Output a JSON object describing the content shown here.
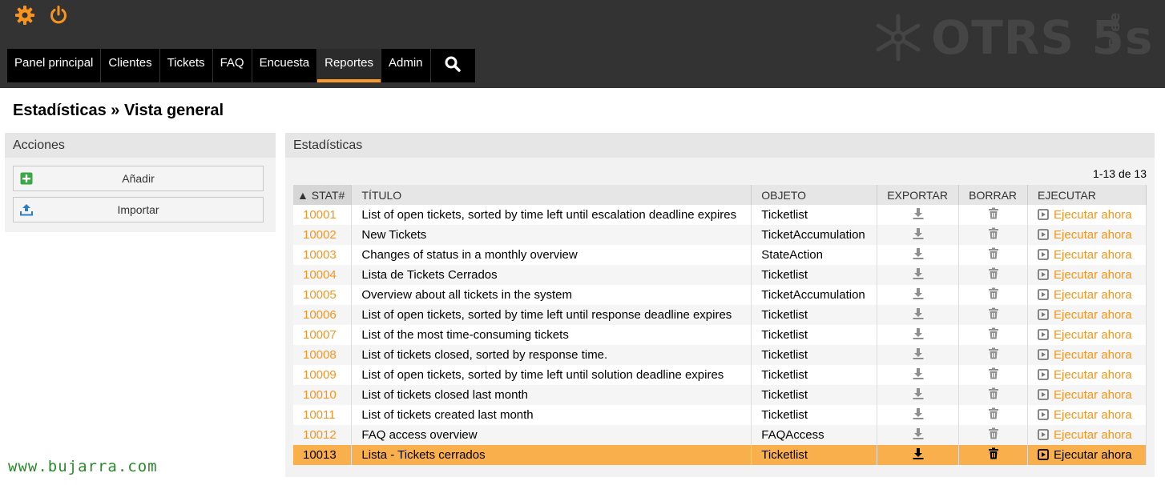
{
  "logo": {
    "text": "OTRS 5s",
    "edition": "Free"
  },
  "nav": {
    "items": [
      {
        "label": "Panel principal",
        "name": "nav-panel-principal"
      },
      {
        "label": "Clientes",
        "name": "nav-clientes"
      },
      {
        "label": "Tickets",
        "name": "nav-tickets"
      },
      {
        "label": "FAQ",
        "name": "nav-faq"
      },
      {
        "label": "Encuesta",
        "name": "nav-encuesta"
      },
      {
        "label": "Reportes",
        "name": "nav-reportes",
        "active": true
      },
      {
        "label": "Admin",
        "name": "nav-admin"
      }
    ]
  },
  "page": {
    "title": "Estadísticas » Vista general"
  },
  "actions": {
    "heading": "Acciones",
    "add_label": "Añadir",
    "import_label": "Importar"
  },
  "stats": {
    "heading": "Estadísticas",
    "pager": "1-13 de 13",
    "columns": [
      "▲ STAT#",
      "TÍTULO",
      "OBJETO",
      "EXPORTAR",
      "BORRAR",
      "EJECUTAR"
    ],
    "run_label": "Ejecutar ahora",
    "rows": [
      {
        "id": "10001",
        "title": "List of open tickets, sorted by time left until escalation deadline expires",
        "object": "Ticketlist"
      },
      {
        "id": "10002",
        "title": "New Tickets",
        "object": "TicketAccumulation"
      },
      {
        "id": "10003",
        "title": "Changes of status in a monthly overview",
        "object": "StateAction"
      },
      {
        "id": "10004",
        "title": "Lista de Tickets Cerrados",
        "object": "Ticketlist"
      },
      {
        "id": "10005",
        "title": "Overview about all tickets in the system",
        "object": "TicketAccumulation"
      },
      {
        "id": "10006",
        "title": "List of open tickets, sorted by time left until response deadline expires",
        "object": "Ticketlist"
      },
      {
        "id": "10007",
        "title": "List of the most time-consuming tickets",
        "object": "Ticketlist"
      },
      {
        "id": "10008",
        "title": "List of tickets closed, sorted by response time.",
        "object": "Ticketlist"
      },
      {
        "id": "10009",
        "title": "List of open tickets, sorted by time left until solution deadline expires",
        "object": "Ticketlist"
      },
      {
        "id": "10010",
        "title": "List of tickets closed last month",
        "object": "Ticketlist"
      },
      {
        "id": "10011",
        "title": "List of tickets created last month",
        "object": "Ticketlist"
      },
      {
        "id": "10012",
        "title": "FAQ access overview",
        "object": "FAQAccess"
      },
      {
        "id": "10013",
        "title": "Lista - Tickets cerrados",
        "object": "Ticketlist",
        "selected": true
      }
    ]
  },
  "watermark": "www.bujarra.com",
  "colors": {
    "accent": "#f7941d",
    "selected_row": "#f9b04c",
    "topbar": "#333333",
    "nav": "#000000"
  },
  "icons": {
    "settings": "gear-icon",
    "logout": "power-icon",
    "search": "search-icon",
    "add": "plus-square-icon",
    "import": "upload-icon",
    "export": "download-icon",
    "delete": "trash-icon",
    "run": "play-icon"
  }
}
